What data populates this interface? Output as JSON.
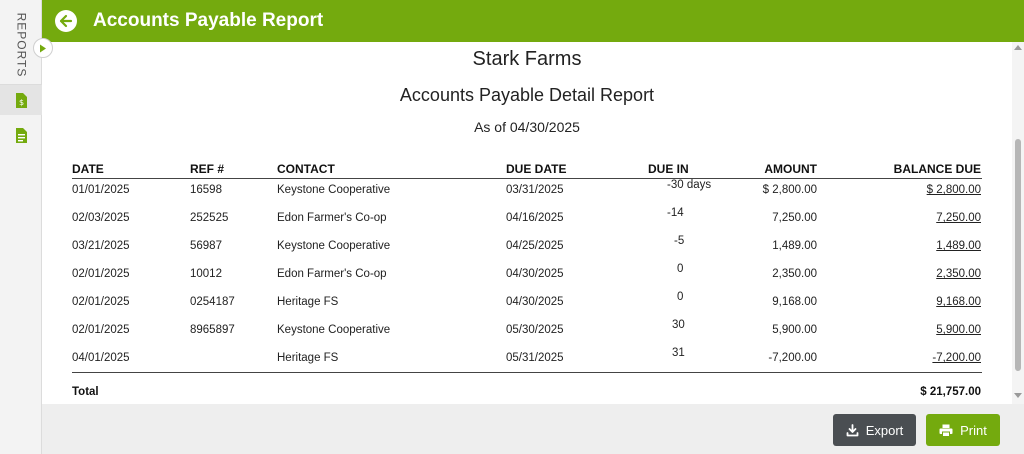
{
  "header": {
    "title": "Accounts Payable Report"
  },
  "sidebar": {
    "label": "REPORTS"
  },
  "report": {
    "company": "Stark Farms",
    "title": "Accounts Payable Detail Report",
    "as_of": "As of 04/30/2025",
    "columns": {
      "date": "DATE",
      "ref": "REF #",
      "contact": "CONTACT",
      "due_date": "DUE DATE",
      "due_in": "DUE IN",
      "amount": "AMOUNT",
      "balance": "BALANCE DUE"
    },
    "rows": [
      {
        "date": "01/01/2025",
        "ref": "16598",
        "contact": "Keystone Cooperative",
        "due_date": "03/31/2025",
        "due_in": "-30 days",
        "amount": "$ 2,800.00",
        "balance": "$ 2,800.00"
      },
      {
        "date": "02/03/2025",
        "ref": "252525",
        "contact": "Edon Farmer's Co-op",
        "due_date": "04/16/2025",
        "due_in": "-14",
        "amount": "7,250.00",
        "balance": "7,250.00"
      },
      {
        "date": "03/21/2025",
        "ref": "56987",
        "contact": "Keystone Cooperative",
        "due_date": "04/25/2025",
        "due_in": "-5",
        "amount": "1,489.00",
        "balance": "1,489.00"
      },
      {
        "date": "02/01/2025",
        "ref": "10012",
        "contact": "Edon Farmer's Co-op",
        "due_date": "04/30/2025",
        "due_in": "0",
        "amount": "2,350.00",
        "balance": "2,350.00"
      },
      {
        "date": "02/01/2025",
        "ref": "0254187",
        "contact": "Heritage FS",
        "due_date": "04/30/2025",
        "due_in": "0",
        "amount": "9,168.00",
        "balance": "9,168.00"
      },
      {
        "date": "02/01/2025",
        "ref": "8965897",
        "contact": "Keystone Cooperative",
        "due_date": "05/30/2025",
        "due_in": "30",
        "amount": "5,900.00",
        "balance": "5,900.00"
      },
      {
        "date": "04/01/2025",
        "ref": "",
        "contact": "Heritage FS",
        "due_date": "05/31/2025",
        "due_in": "31",
        "amount": "-7,200.00",
        "balance": "-7,200.00"
      }
    ],
    "total_label": "Total",
    "total_value": "$ 21,757.00"
  },
  "footer": {
    "export_label": "Export",
    "print_label": "Print"
  },
  "colors": {
    "brand_green": "#74aa0e",
    "export_gray": "#4a4e52"
  }
}
